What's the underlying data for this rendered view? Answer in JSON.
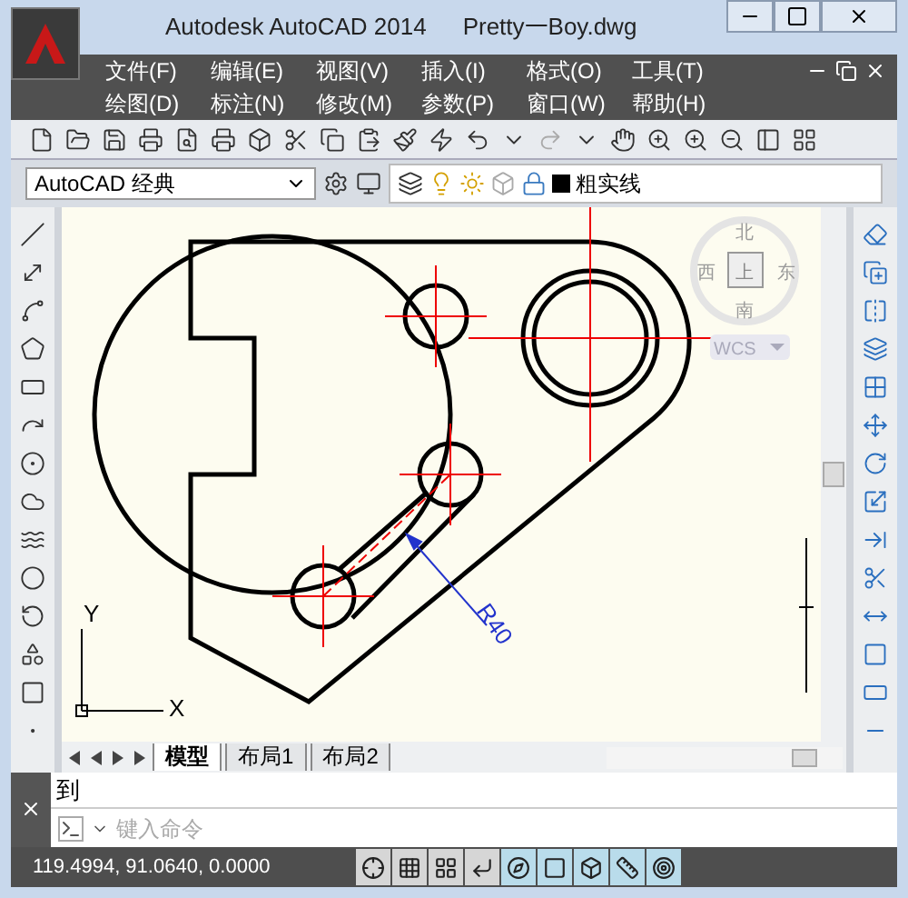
{
  "window": {
    "app_title": "Autodesk AutoCAD 2014",
    "file_title": "Pretty一Boy.dwg"
  },
  "menu_rows": [
    [
      "文件(F)",
      "编辑(E)",
      "视图(V)",
      "插入(I)",
      "格式(O)",
      "工具(T)"
    ],
    [
      "绘图(D)",
      "标注(N)",
      "修改(M)",
      "参数(P)",
      "窗口(W)",
      "帮助(H)"
    ]
  ],
  "workspace": {
    "value": "AutoCAD 经典"
  },
  "layer": {
    "name": "粗实线"
  },
  "viewcube": {
    "north": "北",
    "west": "西",
    "top": "上",
    "east": "东",
    "south": "南",
    "ucs": "WCS"
  },
  "drawing": {
    "dimension": "R40",
    "axis_x": "X",
    "axis_y": "Y"
  },
  "layout_tabs": [
    {
      "label": "模型",
      "selected": true
    },
    {
      "label": "布局1",
      "selected": false
    },
    {
      "label": "布局2",
      "selected": false
    }
  ],
  "command": {
    "history": "到",
    "placeholder": "键入命令"
  },
  "status_bar": {
    "coordinates": "119.4994, 91.0640, 0.0000",
    "toggles": [
      {
        "on": false
      },
      {
        "on": false
      },
      {
        "on": false
      },
      {
        "on": false
      },
      {
        "on": true
      },
      {
        "on": true
      },
      {
        "on": true
      },
      {
        "on": true
      },
      {
        "on": true
      }
    ]
  }
}
